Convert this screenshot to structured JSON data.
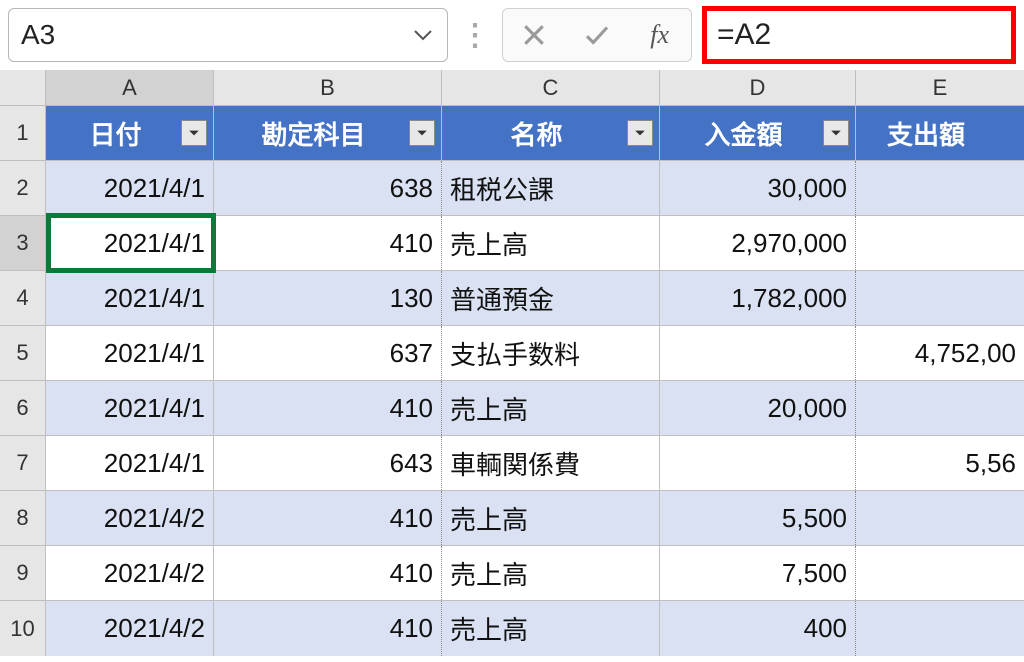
{
  "nameBox": {
    "value": "A3"
  },
  "formulaBar": {
    "value": "=A2"
  },
  "columns": [
    "A",
    "B",
    "C",
    "D",
    "E"
  ],
  "headers": {
    "A": "日付",
    "B": "勘定科目",
    "C": "名称",
    "D": "入金額",
    "E": "支出額"
  },
  "rows": [
    {
      "n": 2,
      "A": "2021/4/1",
      "B": "638",
      "C": "租税公課",
      "D": "30,000",
      "E": ""
    },
    {
      "n": 3,
      "A": "2021/4/1",
      "B": "410",
      "C": "売上高",
      "D": "2,970,000",
      "E": ""
    },
    {
      "n": 4,
      "A": "2021/4/1",
      "B": "130",
      "C": "普通預金",
      "D": "1,782,000",
      "E": ""
    },
    {
      "n": 5,
      "A": "2021/4/1",
      "B": "637",
      "C": "支払手数料",
      "D": "",
      "E": "4,752,00"
    },
    {
      "n": 6,
      "A": "2021/4/1",
      "B": "410",
      "C": "売上高",
      "D": "20,000",
      "E": ""
    },
    {
      "n": 7,
      "A": "2021/4/1",
      "B": "643",
      "C": "車輌関係費",
      "D": "",
      "E": "5,56"
    },
    {
      "n": 8,
      "A": "2021/4/2",
      "B": "410",
      "C": "売上高",
      "D": "5,500",
      "E": ""
    },
    {
      "n": 9,
      "A": "2021/4/2",
      "B": "410",
      "C": "売上高",
      "D": "7,500",
      "E": ""
    },
    {
      "n": 10,
      "A": "2021/4/2",
      "B": "410",
      "C": "売上高",
      "D": "400",
      "E": ""
    }
  ],
  "selection": {
    "activeCell": "A3",
    "row": 3,
    "col": "A"
  }
}
